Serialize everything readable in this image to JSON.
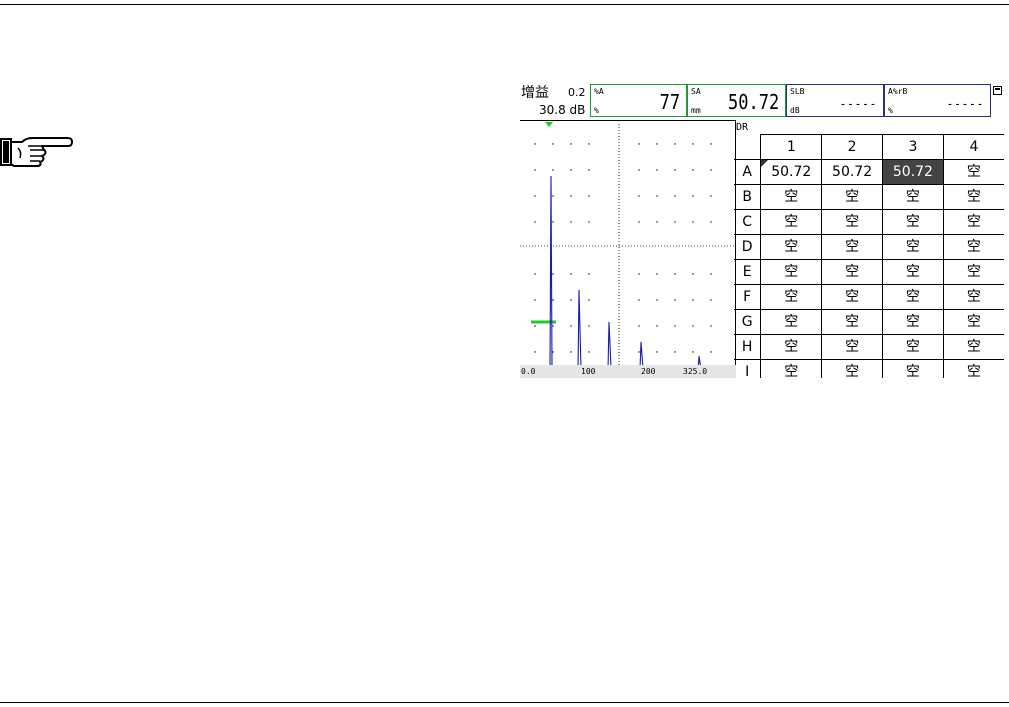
{
  "gain": {
    "label": "增益",
    "step": "0.2",
    "value": "30.8 dB"
  },
  "measure_fields": [
    {
      "label": "%A",
      "unit": "%",
      "value": "77",
      "color": "#1f9a34"
    },
    {
      "label": "SA",
      "unit": "mm",
      "value": "50.72",
      "color": "#1f9a34"
    },
    {
      "label": "SLB",
      "unit": "dB",
      "value": "-----",
      "color": "#27307a"
    },
    {
      "label": "A%rB",
      "unit": "%",
      "value": "-----",
      "color": "#27307a"
    }
  ],
  "ascan": {
    "x_ticks": [
      "0.0",
      "100",
      "200",
      "325.0"
    ],
    "signal_color": "#1a1aa8",
    "gate_color": "#22cc22"
  },
  "dr_table": {
    "label": "DR",
    "columns": [
      "1",
      "2",
      "3",
      "4"
    ],
    "rows": [
      {
        "label": "A",
        "cells": [
          "50.72",
          "50.72",
          "50.72",
          "空"
        ]
      },
      {
        "label": "B",
        "cells": [
          "空",
          "空",
          "空",
          "空"
        ]
      },
      {
        "label": "C",
        "cells": [
          "空",
          "空",
          "空",
          "空"
        ]
      },
      {
        "label": "D",
        "cells": [
          "空",
          "空",
          "空",
          "空"
        ]
      },
      {
        "label": "E",
        "cells": [
          "空",
          "空",
          "空",
          "空"
        ]
      },
      {
        "label": "F",
        "cells": [
          "空",
          "空",
          "空",
          "空"
        ]
      },
      {
        "label": "G",
        "cells": [
          "空",
          "空",
          "空",
          "空"
        ]
      },
      {
        "label": "H",
        "cells": [
          "空",
          "空",
          "空",
          "空"
        ]
      },
      {
        "label": "I",
        "cells": [
          "空",
          "空",
          "空",
          "空"
        ]
      }
    ],
    "selected_cell": "A3"
  },
  "icons": [
    "pointing-hand-icon",
    "save-icon",
    "gate-marker-icon"
  ]
}
